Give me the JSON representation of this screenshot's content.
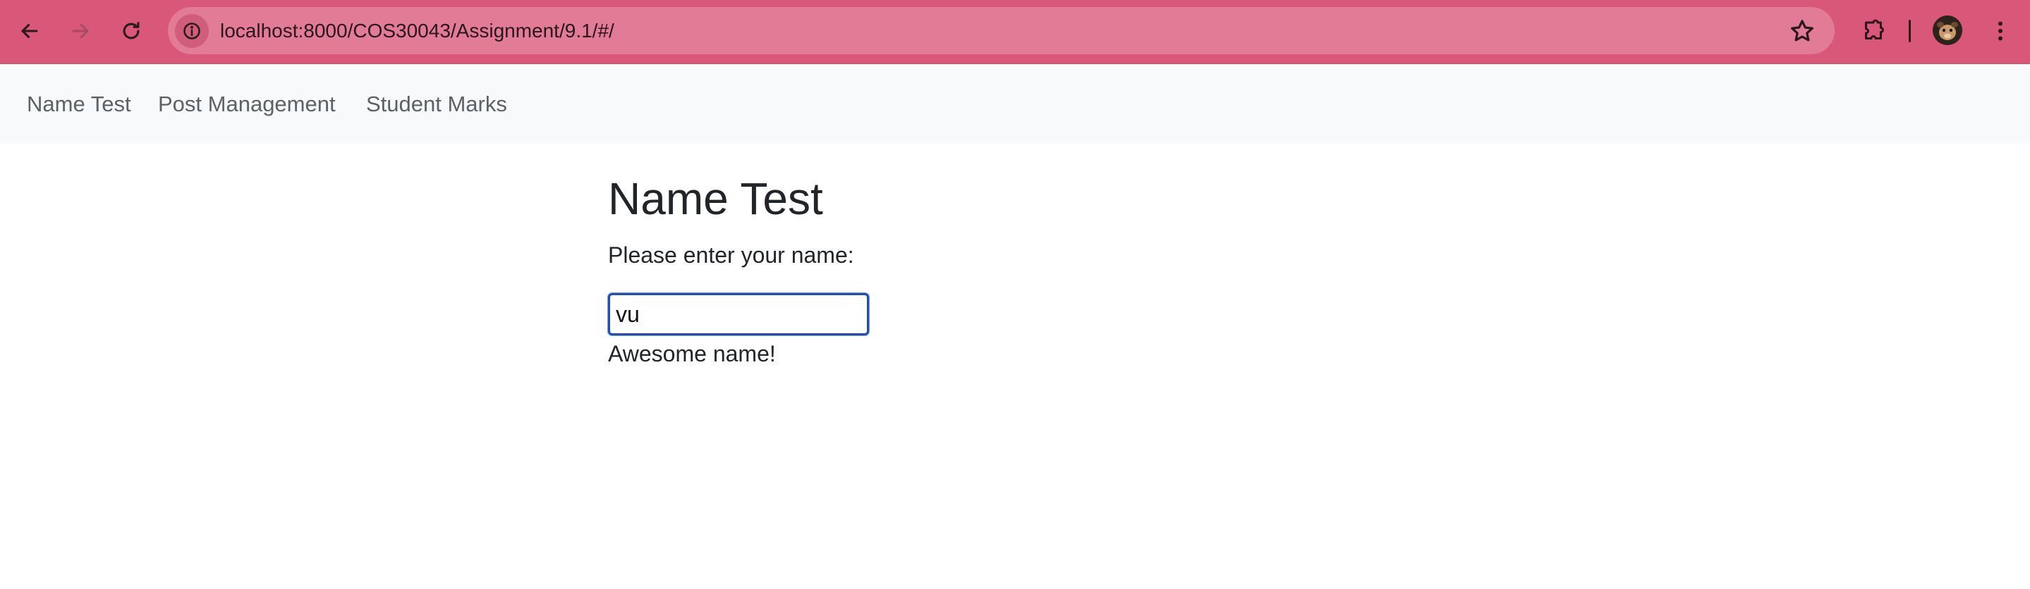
{
  "browser": {
    "url": "localhost:8000/COS30043/Assignment/9.1/#/",
    "icons": {
      "back": "back-arrow-icon",
      "forward": "forward-arrow-icon",
      "reload": "reload-icon",
      "site_info": "info-icon",
      "bookmark": "star-icon",
      "extensions": "puzzle-icon",
      "profile": "avatar",
      "menu": "kebab-menu-icon"
    },
    "colors": {
      "toolbar": "#d9587a",
      "omnibox": "#e27b95"
    }
  },
  "navbar": {
    "links": [
      {
        "label": "Name Test"
      },
      {
        "label": "Post Management"
      },
      {
        "label": "Student Marks"
      }
    ]
  },
  "main": {
    "title": "Name Test",
    "prompt": "Please enter your name:",
    "name_value": "vu",
    "feedback": "Awesome name!"
  }
}
